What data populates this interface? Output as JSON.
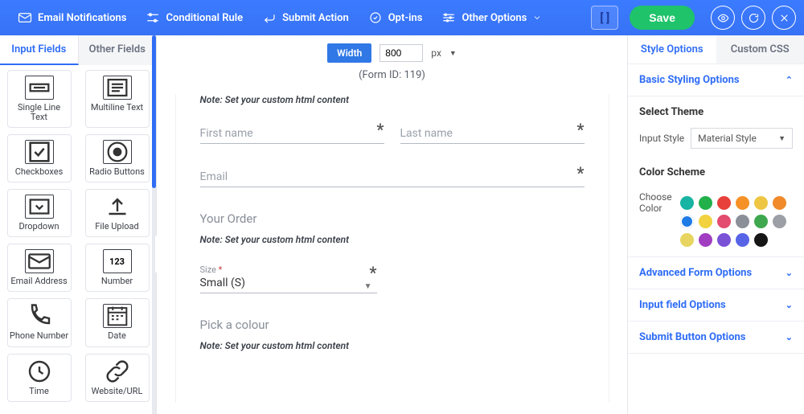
{
  "topbar": {
    "email": "Email Notifications",
    "conditional": "Conditional Rule",
    "submit": "Submit Action",
    "optins": "Opt-ins",
    "other": "Other Options",
    "save": "Save",
    "brackets": "[ ]"
  },
  "left": {
    "tabs": {
      "input": "Input Fields",
      "other": "Other Fields"
    },
    "fields": [
      {
        "label": "Single Line Text"
      },
      {
        "label": "Multiline Text"
      },
      {
        "label": "Checkboxes"
      },
      {
        "label": "Radio Buttons"
      },
      {
        "label": "Dropdown"
      },
      {
        "label": "File Upload"
      },
      {
        "label": "Email Address"
      },
      {
        "label": "Number"
      },
      {
        "label": "Phone Number"
      },
      {
        "label": "Date"
      },
      {
        "label": "Time"
      },
      {
        "label": "Website/URL"
      }
    ]
  },
  "canvas": {
    "width_label": "Width",
    "width_value": "800",
    "width_unit": "px",
    "form_id": "(Form ID: 119)",
    "note": "Note: Set your custom html content",
    "first_name": "First name",
    "last_name": "Last name",
    "email": "Email",
    "order": "Your Order",
    "size_label": "Size",
    "size_value": "Small (S)",
    "colour": "Pick a colour",
    "star": "*"
  },
  "right": {
    "tabs": {
      "style": "Style Options",
      "css": "Custom CSS"
    },
    "basic": "Basic Styling Options",
    "select_theme": "Select Theme",
    "input_style_lbl": "Input Style",
    "input_style_val": "Material Style",
    "color_scheme": "Color Scheme",
    "choose_color": "Choose Color",
    "swatches": [
      "#17b3a3",
      "#21b04a",
      "#e8403a",
      "#f59126",
      "#eec643",
      "#f08a2a",
      "#1e7be6",
      "#f2d23e",
      "#e34b6f",
      "#8b8f98",
      "#3fa84e",
      "#9c9fa6",
      "#e7d55f",
      "#a13dc0",
      "#7a52d6",
      "#5864e6",
      "#161616"
    ],
    "advanced": "Advanced Form Options",
    "input_opts": "Input field Options",
    "submit_opts": "Submit Button Options"
  }
}
